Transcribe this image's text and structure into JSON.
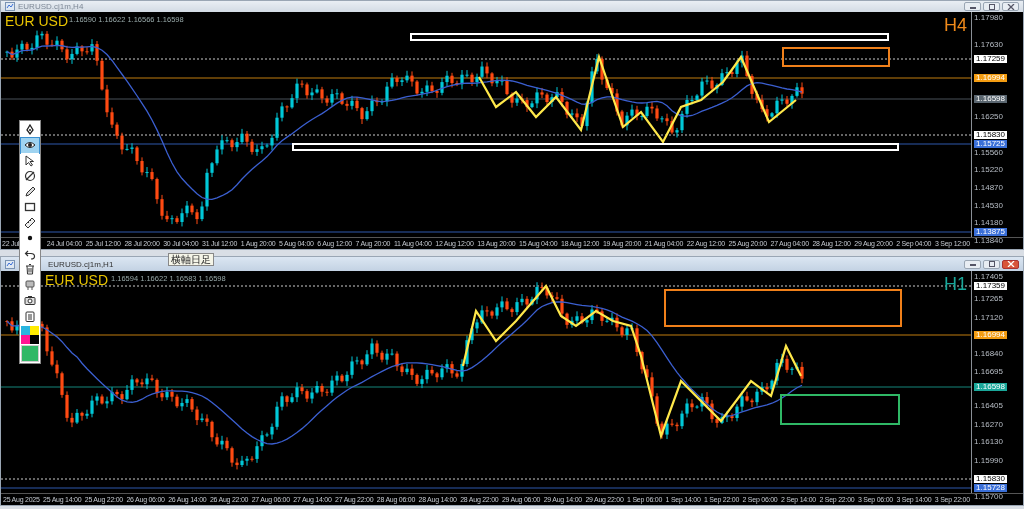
{
  "windows": [
    {
      "title": "EURUSD.cj1m,H4",
      "active": false,
      "symbol": "EUR USD",
      "quote": "1.16590 1.16622 1.16566 1.16598",
      "timeframe": "H4",
      "price_labels": [
        {
          "text": "1.17980",
          "kind": "plain"
        },
        {
          "text": "1.17630",
          "kind": "plain"
        },
        {
          "text": "1.17259",
          "kind": "tag",
          "color": "#ffffff"
        },
        {
          "text": "1.16994",
          "kind": "tag",
          "color": "#f39c12"
        },
        {
          "text": "1.16598",
          "kind": "tag",
          "color": "#5a6670"
        },
        {
          "text": "1.16250",
          "kind": "plain"
        },
        {
          "text": "1.15830",
          "kind": "tag",
          "color": "#ffffff"
        },
        {
          "text": "1.15725",
          "kind": "tag",
          "color": "#3a6fd8"
        },
        {
          "text": "1.15560",
          "kind": "plain"
        },
        {
          "text": "1.15220",
          "kind": "plain"
        },
        {
          "text": "1.14870",
          "kind": "plain"
        },
        {
          "text": "1.14530",
          "kind": "plain"
        },
        {
          "text": "1.14180",
          "kind": "plain"
        },
        {
          "text": "1.13875",
          "kind": "tag",
          "color": "#3a6fd8"
        },
        {
          "text": "1.13840",
          "kind": "plain"
        }
      ],
      "time_labels": [
        "22 Jul",
        "24 Jul 04:00",
        "25 Jul 12:00",
        "28 Jul 20:00",
        "30 Jul 04:00",
        "31 Jul 12:00",
        "1 Aug 20:00",
        "5 Aug 04:00",
        "6 Aug 12:00",
        "7 Aug 20:00",
        "11 Aug 04:00",
        "12 Aug 12:00",
        "13 Aug 20:00",
        "15 Aug 04:00",
        "18 Aug 12:00",
        "19 Aug 20:00",
        "21 Aug 04:00",
        "22 Aug 12:00",
        "25 Aug 20:00",
        "27 Aug 04:00",
        "28 Aug 12:00",
        "29 Aug 20:00",
        "2 Sep 04:00",
        "3 Sep 12:00"
      ]
    },
    {
      "title": "EURUSD.cj1m,H1",
      "active": true,
      "symbol": "EUR USD",
      "quote": "1.16594 1.16622 1.16583 1.16598",
      "timeframe": "H1",
      "price_labels": [
        {
          "text": "1.17405",
          "kind": "plain"
        },
        {
          "text": "1.17359",
          "kind": "tag",
          "color": "#ffffff"
        },
        {
          "text": "1.17265",
          "kind": "plain"
        },
        {
          "text": "1.17120",
          "kind": "plain"
        },
        {
          "text": "1.16994",
          "kind": "tag",
          "color": "#f39c12"
        },
        {
          "text": "1.16840",
          "kind": "plain"
        },
        {
          "text": "1.16695",
          "kind": "plain"
        },
        {
          "text": "1.16598",
          "kind": "tag",
          "color": "#1aa79a"
        },
        {
          "text": "1.16405",
          "kind": "plain"
        },
        {
          "text": "1.16270",
          "kind": "plain"
        },
        {
          "text": "1.16130",
          "kind": "plain"
        },
        {
          "text": "1.15990",
          "kind": "plain"
        },
        {
          "text": "1.15830",
          "kind": "tag",
          "color": "#ffffff"
        },
        {
          "text": "1.15728",
          "kind": "tag",
          "color": "#3a6fd8"
        },
        {
          "text": "1.15700",
          "kind": "plain"
        }
      ],
      "time_labels": [
        "25 Aug 2025",
        "25 Aug 14:00",
        "25 Aug 22:00",
        "26 Aug 06:00",
        "26 Aug 14:00",
        "26 Aug 22:00",
        "27 Aug 06:00",
        "27 Aug 14:00",
        "27 Aug 22:00",
        "28 Aug 06:00",
        "28 Aug 14:00",
        "28 Aug 22:00",
        "29 Aug 06:00",
        "29 Aug 14:00",
        "29 Aug 22:00",
        "1 Sep 06:00",
        "1 Sep 14:00",
        "1 Sep 22:00",
        "2 Sep 06:00",
        "2 Sep 14:00",
        "2 Sep 22:00",
        "3 Sep 06:00",
        "3 Sep 14:00",
        "3 Sep 22:00"
      ]
    }
  ],
  "tooltip": "横軸日足",
  "toolbar": {
    "tools": [
      {
        "kind": "pen",
        "selected": false
      },
      {
        "kind": "eye",
        "selected": true
      },
      {
        "kind": "cursor",
        "selected": false
      },
      {
        "kind": "disable",
        "selected": false
      },
      {
        "kind": "pencil",
        "selected": false
      },
      {
        "kind": "rectangle",
        "selected": false
      },
      {
        "kind": "ruler",
        "selected": false
      },
      {
        "kind": "dot",
        "selected": false
      },
      {
        "kind": "undo",
        "selected": false
      },
      {
        "kind": "trash",
        "selected": false
      },
      {
        "kind": "stamp",
        "selected": false
      },
      {
        "kind": "camera",
        "selected": false
      },
      {
        "kind": "clipboard",
        "selected": false
      }
    ],
    "colors": [
      {
        "color": "#29b6e0"
      },
      {
        "color": "#ffeb00"
      },
      {
        "color": "#ff1493"
      },
      {
        "color": "#000000"
      }
    ],
    "current": {
      "color": "#2fb866"
    }
  }
}
